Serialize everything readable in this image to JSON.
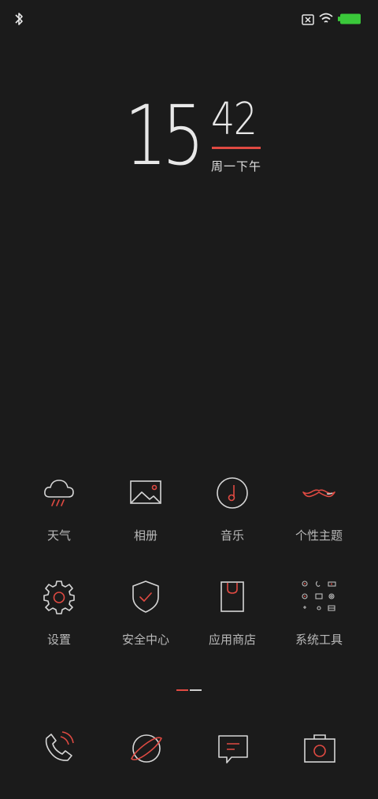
{
  "status_bar": {
    "icons": [
      "bluetooth-icon",
      "no-sim-icon",
      "wifi-icon",
      "battery-icon"
    ],
    "battery_color": "#3ac83a"
  },
  "clock": {
    "hour": "15",
    "minute": "42",
    "date_text": "周一下午",
    "accent_color": "#e04a42"
  },
  "apps": [
    {
      "label": "天气",
      "icon": "weather-icon"
    },
    {
      "label": "相册",
      "icon": "gallery-icon"
    },
    {
      "label": "音乐",
      "icon": "music-icon"
    },
    {
      "label": "个性主题",
      "icon": "themes-icon"
    },
    {
      "label": "设置",
      "icon": "settings-icon"
    },
    {
      "label": "安全中心",
      "icon": "security-icon"
    },
    {
      "label": "应用商店",
      "icon": "app-store-icon"
    },
    {
      "label": "系统工具",
      "icon": "system-tools-icon"
    }
  ],
  "page_indicator": {
    "pages": 2,
    "current": 1
  },
  "dock": [
    "phone-icon",
    "browser-icon",
    "messages-icon",
    "camera-icon"
  ]
}
